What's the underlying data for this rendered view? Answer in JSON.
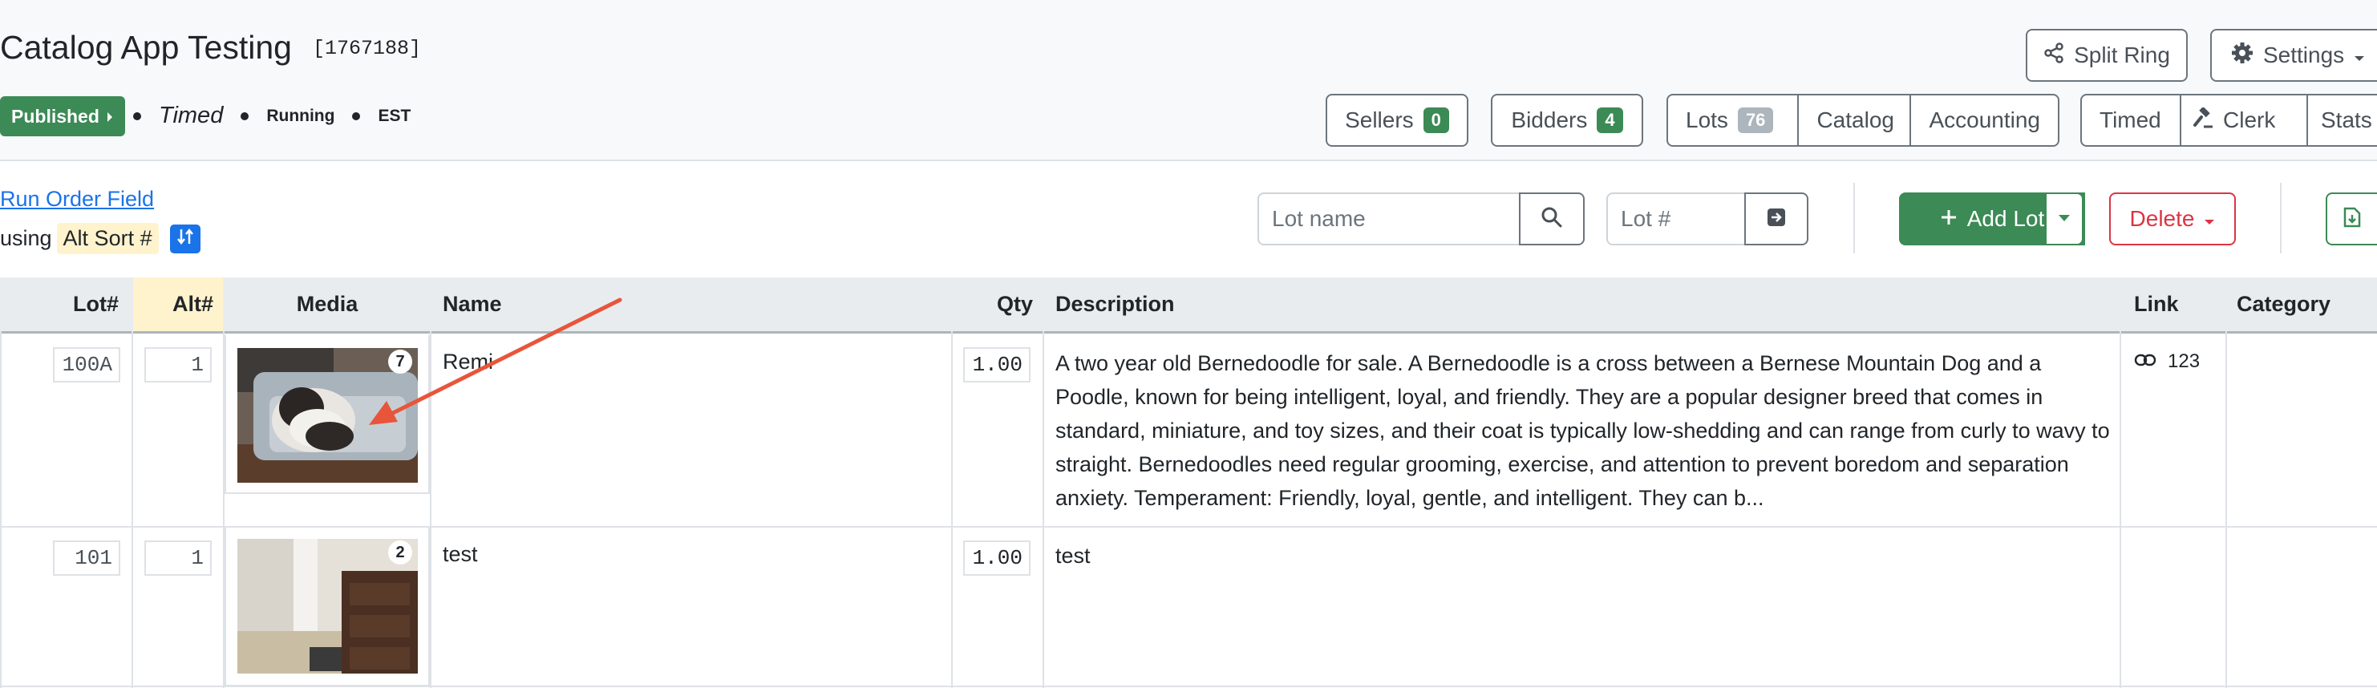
{
  "header": {
    "title": "Catalog App Testing",
    "app_id": "[1767188]",
    "status_button": "Published",
    "meta": [
      "Timed",
      "Running",
      "EST"
    ],
    "split_ring": "Split Ring",
    "settings": "Settings",
    "sellers": {
      "label": "Sellers",
      "count": "0"
    },
    "bidders": {
      "label": "Bidders",
      "count": "4"
    },
    "nav_group_1": [
      {
        "label": "Lots",
        "count": "76"
      },
      {
        "label": "Catalog"
      },
      {
        "label": "Accounting"
      }
    ],
    "nav_group_2": [
      {
        "label": "Timed"
      },
      {
        "label": "Clerk"
      },
      {
        "label": "Stats"
      }
    ]
  },
  "toolbar": {
    "run_order_link": "Run Order Field",
    "using_label": "using",
    "sort_field": "Alt Sort #",
    "lot_name_placeholder": "Lot name",
    "lot_num_placeholder": "Lot #",
    "add_lot": "Add Lot",
    "delete": "Delete"
  },
  "table": {
    "headers": {
      "lot": "Lot#",
      "alt": "Alt#",
      "media": "Media",
      "name": "Name",
      "qty": "Qty",
      "description": "Description",
      "link": "Link",
      "category": "Category"
    },
    "rows": [
      {
        "lot": "100A",
        "alt": "1",
        "media_count": "7",
        "name": "Remi",
        "qty": "1.00",
        "description": "A two year old Bernedoodle for sale. A Bernedoodle is a cross between a Bernese Mountain Dog and a Poodle, known for being intelligent, loyal, and friendly. They are a popular designer breed that comes in standard, miniature, and toy sizes, and their coat is typically low-shedding and can range from curly to wavy to straight. Bernedoodles need regular grooming, exercise, and attention to prevent boredom and separation anxiety.  Temperament: Friendly, loyal, gentle, and intelligent. They can b...",
        "link": "123",
        "category": ""
      },
      {
        "lot": "101",
        "alt": "1",
        "media_count": "2",
        "name": "test",
        "qty": "1.00",
        "description": "test",
        "link": "",
        "category": ""
      }
    ]
  },
  "colors": {
    "accent_green": "#3c8a55",
    "delete_red": "#dc3545",
    "link_blue": "#1a73e8",
    "alt_highlight": "#fff3cd",
    "arrow_red": "#e8553a"
  }
}
